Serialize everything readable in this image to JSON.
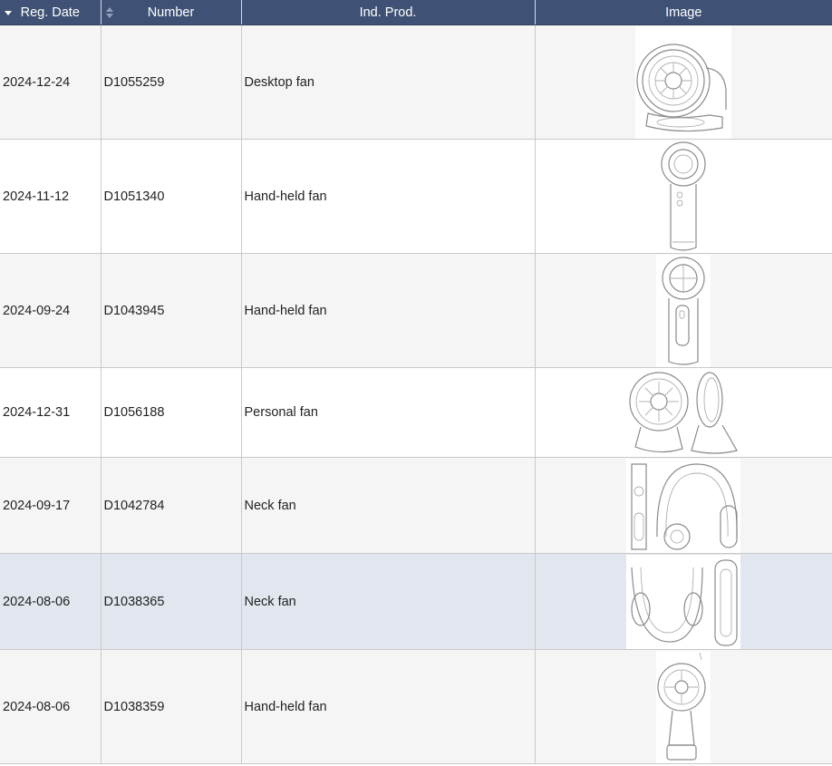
{
  "table": {
    "columns": [
      {
        "key": "reg_date",
        "label": "Reg. Date"
      },
      {
        "key": "number",
        "label": "Number"
      },
      {
        "key": "ind_prod",
        "label": "Ind. Prod."
      },
      {
        "key": "image",
        "label": "Image"
      }
    ],
    "rows": [
      {
        "reg_date": "2024-12-24",
        "number": "D1055259",
        "ind_prod": "Desktop fan",
        "image_icon": "desktop-fan-drawing-icon"
      },
      {
        "reg_date": "2024-11-12",
        "number": "D1051340",
        "ind_prod": "Hand-held fan",
        "image_icon": "handheld-fan-drawing-icon"
      },
      {
        "reg_date": "2024-09-24",
        "number": "D1043945",
        "ind_prod": "Hand-held fan",
        "image_icon": "handheld-fan-drawing-icon"
      },
      {
        "reg_date": "2024-12-31",
        "number": "D1056188",
        "ind_prod": "Personal fan",
        "image_icon": "personal-fan-drawing-icon"
      },
      {
        "reg_date": "2024-09-17",
        "number": "D1042784",
        "ind_prod": "Neck fan",
        "image_icon": "neck-fan-drawing-icon"
      },
      {
        "reg_date": "2024-08-06",
        "number": "D1038365",
        "ind_prod": "Neck fan",
        "image_icon": "neck-fan-drawing-icon"
      },
      {
        "reg_date": "2024-08-06",
        "number": "D1038359",
        "ind_prod": "Hand-held fan",
        "image_icon": "handheld-fan-drawing-icon"
      }
    ]
  },
  "colors": {
    "header_bg": "#3f5275",
    "header_text": "#ffffff",
    "row_odd": "#f5f5f5",
    "row_even": "#ffffff",
    "row_selected": "#e2e6ee"
  }
}
